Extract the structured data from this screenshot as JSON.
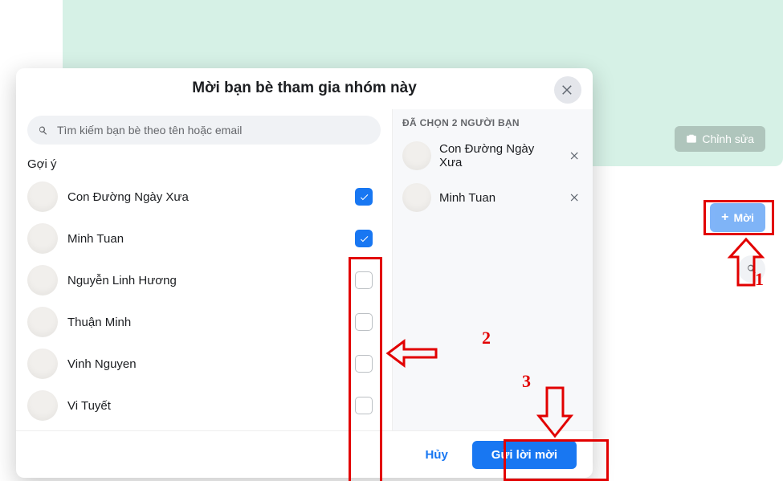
{
  "cover": {
    "edit_label": "Chỉnh sửa",
    "invite_label": "Mời"
  },
  "modal": {
    "title": "Mời bạn bè tham gia nhóm này",
    "search_placeholder": "Tìm kiếm bạn bè theo tên hoặc email",
    "suggestions_label": "Gợi ý",
    "selected_header": "ĐÃ CHỌN 2 NGƯỜI BẠN",
    "cancel_label": "Hủy",
    "send_label": "Gửi lời mời"
  },
  "suggestions": [
    {
      "name": "Con Đường Ngày Xưa",
      "checked": true
    },
    {
      "name": "Minh Tuan",
      "checked": true
    },
    {
      "name": "Nguyễn Linh Hương",
      "checked": false
    },
    {
      "name": "Thuận Minh",
      "checked": false
    },
    {
      "name": "Vinh Nguyen",
      "checked": false
    },
    {
      "name": "Vi Tuyết",
      "checked": false
    }
  ],
  "selected": [
    {
      "name": "Con Đường Ngày Xưa"
    },
    {
      "name": "Minh Tuan"
    }
  ],
  "annotations": {
    "step1": "1",
    "step2": "2",
    "step3": "3"
  }
}
